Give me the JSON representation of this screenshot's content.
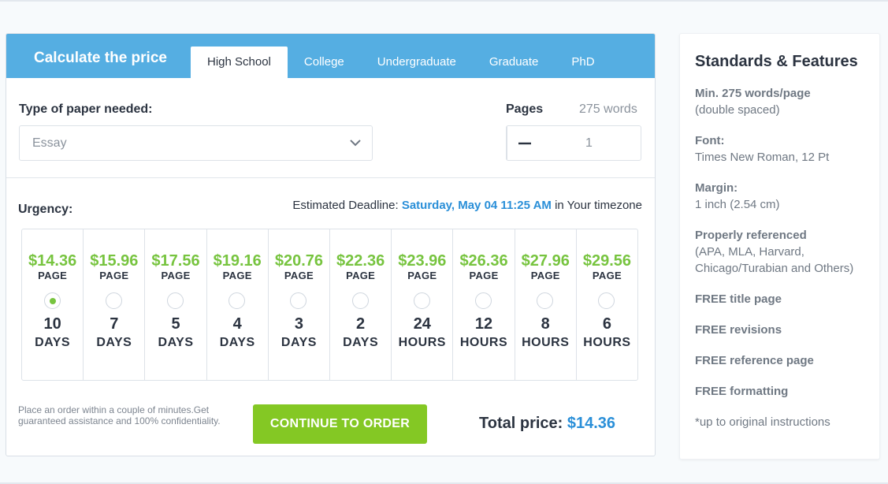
{
  "calculator": {
    "title": "Calculate the price",
    "tabs": [
      {
        "label": "High School",
        "active": true
      },
      {
        "label": "College",
        "active": false
      },
      {
        "label": "Undergraduate",
        "active": false
      },
      {
        "label": "Graduate",
        "active": false
      },
      {
        "label": "PhD",
        "active": false
      }
    ],
    "paper": {
      "label": "Type of paper needed:",
      "value": "Essay"
    },
    "pages": {
      "label": "Pages",
      "words": "275 words",
      "value": "1"
    },
    "urgency": {
      "label": "Urgency:",
      "deadline_prefix": "Estimated Deadline:",
      "deadline_date": "Saturday, May 04 11:25 AM",
      "deadline_suffix": "in Your timezone",
      "options": [
        {
          "price": "$14.36",
          "per": "PAGE",
          "amount": "10",
          "unit": "DAYS",
          "selected": true
        },
        {
          "price": "$15.96",
          "per": "PAGE",
          "amount": "7",
          "unit": "DAYS",
          "selected": false
        },
        {
          "price": "$17.56",
          "per": "PAGE",
          "amount": "5",
          "unit": "DAYS",
          "selected": false
        },
        {
          "price": "$19.16",
          "per": "PAGE",
          "amount": "4",
          "unit": "DAYS",
          "selected": false
        },
        {
          "price": "$20.76",
          "per": "PAGE",
          "amount": "3",
          "unit": "DAYS",
          "selected": false
        },
        {
          "price": "$22.36",
          "per": "PAGE",
          "amount": "2",
          "unit": "DAYS",
          "selected": false
        },
        {
          "price": "$23.96",
          "per": "PAGE",
          "amount": "24",
          "unit": "HOURS",
          "selected": false
        },
        {
          "price": "$26.36",
          "per": "PAGE",
          "amount": "12",
          "unit": "HOURS",
          "selected": false
        },
        {
          "price": "$27.96",
          "per": "PAGE",
          "amount": "8",
          "unit": "HOURS",
          "selected": false
        },
        {
          "price": "$29.56",
          "per": "PAGE",
          "amount": "6",
          "unit": "HOURS",
          "selected": false
        }
      ]
    },
    "note": "Place an order within a couple of minutes.Get guaranteed assistance and 100% confidentiality.",
    "cta_label": "CONTINUE TO ORDER",
    "total_label": "Total price:",
    "total_value": "$14.36"
  },
  "features": {
    "title": "Standards & Features",
    "items": [
      {
        "head": "Min. 275 words/page",
        "body": "(double spaced)"
      },
      {
        "head": "Font:",
        "body": "Times New Roman, 12 Pt"
      },
      {
        "head": "Margin:",
        "body": "1 inch (2.54 cm)"
      },
      {
        "head": "Properly referenced",
        "body": "(APA, MLA, Harvard, Chicago/Turabian and Others)"
      },
      {
        "head": "FREE title page",
        "body": ""
      },
      {
        "head": "FREE revisions",
        "body": ""
      },
      {
        "head": "FREE reference page",
        "body": ""
      },
      {
        "head": "FREE formatting",
        "body": ""
      },
      {
        "head": "",
        "body": "*up to original instructions"
      }
    ]
  },
  "colors": {
    "header_blue": "#55aee2",
    "price_green": "#77c43f",
    "cta_green": "#84c824",
    "link_blue": "#2a8fd8"
  },
  "icons": {
    "select_arrow": "chevron-down-icon",
    "decrease": "minus-icon",
    "increase": "plus-icon"
  }
}
